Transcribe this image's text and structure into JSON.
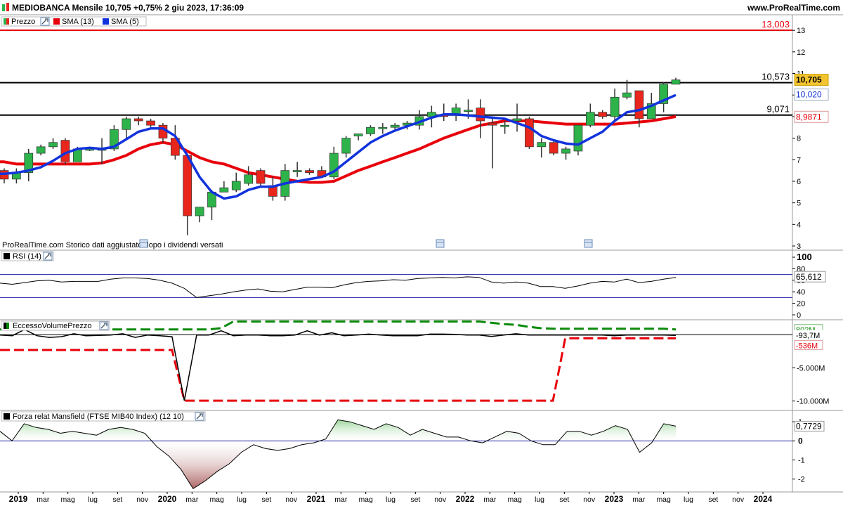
{
  "header": {
    "title": "MEDIOBANCA Mensile 10,705 +0,75% 2 giu 2023, 17:36:09",
    "brand": "www.ProRealTime.com"
  },
  "indicators": {
    "price_label": "Prezzo",
    "sma13_label": "SMA (13)",
    "sma5_label": "SMA (5)"
  },
  "footnote": "ProRealTime.com  Storico dati aggiustato dopo i dividendi versati",
  "colors": {
    "up": "#2db34a",
    "down": "#e8261c",
    "sma13": "#e8000b",
    "sma5": "#1133dd",
    "highlight": "#f4c430",
    "grid_dash": "#0a8a0a",
    "hline_blue": "#2020a0"
  },
  "chart_data": [
    {
      "type": "candlestick",
      "name": "Prezzo",
      "ylim": [
        3,
        13.2
      ],
      "yticks": [
        "3",
        "4",
        "5",
        "6",
        "7",
        "8",
        "9",
        "10",
        "11",
        "12",
        "13"
      ],
      "hlines": [
        {
          "value": 13.003,
          "label": "13,003",
          "color": "#e8000b"
        },
        {
          "value": 10.573,
          "label": "10,573",
          "color": "#000000"
        },
        {
          "value": 9.071,
          "label": "9,071",
          "color": "#000000"
        }
      ],
      "price_tags": [
        {
          "value": 10.705,
          "label": "10,705",
          "style": "highlight"
        },
        {
          "value": 10.02,
          "label": "10,020",
          "style": "blue"
        },
        {
          "value": 8.987,
          "label": "8,9871",
          "style": "red"
        }
      ],
      "candles": [
        [
          6.5,
          6.6,
          5.9,
          6.1
        ],
        [
          6.1,
          6.6,
          5.9,
          6.4
        ],
        [
          6.4,
          7.5,
          6.0,
          7.3
        ],
        [
          7.3,
          7.7,
          7.2,
          7.6
        ],
        [
          7.6,
          8.0,
          7.5,
          7.8
        ],
        [
          7.9,
          8.0,
          6.8,
          6.9
        ],
        [
          6.9,
          7.6,
          6.9,
          7.5
        ],
        [
          7.5,
          7.6,
          7.4,
          7.5
        ],
        [
          7.5,
          8.0,
          6.8,
          7.5
        ],
        [
          7.5,
          8.6,
          7.4,
          8.4
        ],
        [
          8.4,
          9.0,
          8.0,
          8.9
        ],
        [
          8.9,
          9.0,
          8.6,
          8.8
        ],
        [
          8.8,
          8.9,
          8.4,
          8.6
        ],
        [
          8.6,
          8.7,
          7.8,
          8.0
        ],
        [
          8.0,
          8.6,
          7.0,
          7.2
        ],
        [
          7.2,
          7.2,
          3.5,
          4.4
        ],
        [
          4.4,
          4.8,
          4.1,
          4.8
        ],
        [
          4.8,
          5.6,
          4.2,
          5.5
        ],
        [
          5.5,
          6.0,
          5.5,
          5.7
        ],
        [
          5.6,
          6.4,
          5.5,
          6.0
        ],
        [
          5.9,
          6.7,
          5.8,
          6.3
        ],
        [
          6.5,
          6.6,
          5.7,
          5.9
        ],
        [
          5.8,
          6.2,
          5.1,
          5.3
        ],
        [
          5.3,
          6.8,
          5.1,
          6.5
        ],
        [
          6.5,
          6.9,
          6.2,
          6.5
        ],
        [
          6.5,
          6.6,
          6.3,
          6.4
        ],
        [
          6.5,
          6.7,
          6.2,
          6.2
        ],
        [
          6.2,
          7.6,
          6.1,
          7.3
        ],
        [
          7.3,
          8.1,
          7.1,
          8.0
        ],
        [
          8.1,
          8.2,
          7.9,
          8.2
        ],
        [
          8.2,
          8.6,
          8.1,
          8.5
        ],
        [
          8.5,
          8.7,
          8.2,
          8.5
        ],
        [
          8.5,
          8.7,
          8.4,
          8.6
        ],
        [
          8.6,
          8.8,
          8.4,
          8.7
        ],
        [
          8.6,
          9.3,
          8.4,
          9.0
        ],
        [
          9.0,
          9.5,
          8.5,
          9.2
        ],
        [
          9.1,
          9.6,
          8.8,
          9.0
        ],
        [
          9.1,
          9.6,
          8.8,
          9.4
        ],
        [
          9.3,
          9.8,
          8.9,
          9.3
        ],
        [
          9.4,
          9.8,
          8.0,
          8.8
        ],
        [
          8.7,
          8.9,
          6.6,
          8.6
        ],
        [
          8.6,
          8.8,
          8.2,
          8.6
        ],
        [
          8.8,
          9.6,
          8.3,
          8.9
        ],
        [
          8.9,
          9.0,
          7.5,
          7.6
        ],
        [
          7.6,
          8.0,
          7.1,
          7.8
        ],
        [
          7.8,
          7.9,
          7.2,
          7.3
        ],
        [
          7.3,
          7.6,
          7.0,
          7.5
        ],
        [
          7.4,
          8.6,
          7.2,
          8.6
        ],
        [
          8.6,
          9.6,
          8.5,
          9.2
        ],
        [
          9.2,
          9.3,
          8.9,
          9.0
        ],
        [
          9.0,
          10.3,
          8.8,
          9.9
        ],
        [
          9.9,
          10.7,
          9.8,
          10.1
        ],
        [
          10.2,
          10.2,
          8.5,
          8.9
        ],
        [
          8.9,
          10.1,
          8.9,
          9.6
        ],
        [
          9.6,
          10.6,
          9.2,
          10.5
        ],
        [
          10.5,
          10.8,
          10.5,
          10.7
        ]
      ],
      "sma13": [
        6.9,
        6.8,
        6.8,
        6.8,
        6.8,
        6.8,
        6.8,
        6.8,
        6.85,
        7.0,
        7.2,
        7.5,
        7.7,
        7.8,
        7.7,
        7.4,
        7.1,
        6.9,
        6.8,
        6.6,
        6.4,
        6.3,
        6.2,
        6.1,
        6.0,
        5.95,
        5.95,
        6.0,
        6.25,
        6.5,
        6.7,
        6.9,
        7.1,
        7.3,
        7.5,
        7.75,
        8.0,
        8.2,
        8.4,
        8.6,
        8.7,
        8.8,
        8.8,
        8.8,
        8.75,
        8.7,
        8.65,
        8.65,
        8.65,
        8.65,
        8.65,
        8.7,
        8.75,
        8.8,
        8.9,
        9.0
      ],
      "sma5": [
        6.35,
        6.4,
        6.5,
        6.65,
        6.95,
        7.3,
        7.5,
        7.55,
        7.5,
        7.6,
        7.95,
        8.3,
        8.45,
        8.45,
        8.1,
        7.2,
        6.2,
        5.5,
        5.2,
        5.3,
        5.6,
        5.75,
        5.75,
        5.9,
        6.0,
        6.1,
        6.2,
        6.45,
        6.9,
        7.35,
        7.8,
        8.1,
        8.35,
        8.55,
        8.75,
        8.95,
        9.1,
        9.1,
        9.05,
        9.0,
        8.95,
        8.9,
        8.7,
        8.5,
        8.1,
        7.9,
        7.75,
        7.7,
        8.0,
        8.3,
        8.8,
        9.2,
        9.3,
        9.5,
        9.75,
        10.0
      ]
    },
    {
      "type": "line",
      "name": "RSI (14)",
      "ylim": [
        0,
        100
      ],
      "yticks": [
        "100",
        "80",
        "60",
        "40",
        "20",
        "0"
      ],
      "hlines": [
        70,
        30
      ],
      "last_label": "65,612",
      "values": [
        55,
        53,
        56,
        59,
        60,
        57,
        58,
        58,
        58,
        62,
        64,
        64,
        63,
        60,
        55,
        46,
        30,
        33,
        36,
        40,
        43,
        45,
        41,
        40,
        44,
        48,
        48,
        47,
        52,
        56,
        58,
        59,
        61,
        60,
        63,
        64,
        65,
        64,
        66,
        65,
        57,
        55,
        57,
        55,
        49,
        49,
        46,
        50,
        55,
        58,
        57,
        62,
        56,
        58,
        62,
        65
      ]
    },
    {
      "type": "line",
      "name": "EccessoVolumePrezzo",
      "ylim": [
        -11000,
        1200
      ],
      "yticks": [
        "-5.000M",
        "-10.000M"
      ],
      "last_labels": [
        "802M",
        "-93,7M",
        "-536M"
      ],
      "values": [
        -50,
        -150,
        800,
        -150,
        -400,
        -300,
        150,
        -150,
        -100,
        -50,
        150,
        -400,
        -50,
        -150,
        -300,
        -9950,
        -50,
        -50,
        600,
        -150,
        -50,
        -50,
        -150,
        -150,
        -50,
        600,
        -50,
        300,
        -150,
        -50,
        100,
        -50,
        -150,
        -150,
        -150,
        100,
        100,
        50,
        -50,
        -50,
        -250,
        -50,
        150,
        -50,
        -50,
        -50,
        -50,
        -50,
        -50,
        -50,
        -150,
        -50,
        -50,
        -50,
        -50,
        -93.7
      ],
      "upper_band": [
        800,
        800,
        800,
        800,
        800,
        800,
        800,
        800,
        800,
        800,
        800,
        800,
        800,
        800,
        800,
        800,
        800,
        800,
        1000,
        2000,
        2000,
        2000,
        2000,
        2000,
        2000,
        2000,
        2000,
        2000,
        2000,
        2000,
        2000,
        2000,
        2000,
        2000,
        2000,
        2000,
        2000,
        2000,
        2000,
        2000,
        1800,
        1600,
        1500,
        1200,
        1000,
        900,
        900,
        900,
        900,
        900,
        900,
        900,
        900,
        900,
        900,
        802
      ],
      "lower_band": [
        -2300,
        -2300,
        -2300,
        -2300,
        -2300,
        -2300,
        -2300,
        -2300,
        -2300,
        -2300,
        -2300,
        -2300,
        -2300,
        -2300,
        -2300,
        -9950,
        -9950,
        -9950,
        -9950,
        -9950,
        -9950,
        -9950,
        -9950,
        -9950,
        -9950,
        -9950,
        -9950,
        -9950,
        -9950,
        -9950,
        -9950,
        -9950,
        -9950,
        -9950,
        -9950,
        -9950,
        -9950,
        -9950,
        -9950,
        -9950,
        -9950,
        -9950,
        -9950,
        -9950,
        -9950,
        -9950,
        -536,
        -536,
        -536,
        -536,
        -536,
        -536,
        -536,
        -536,
        -536,
        -536
      ]
    },
    {
      "type": "area",
      "name": "Forza relat Mansfield (FTSE MIB40 Index) (12 10)",
      "ylim": [
        -2.6,
        1.3
      ],
      "yticks": [
        "1",
        "0",
        "-1",
        "-2"
      ],
      "last_label": "0,7729",
      "values": [
        0.5,
        0.0,
        0.9,
        0.7,
        0.6,
        0.4,
        0.5,
        0.4,
        0.3,
        0.6,
        0.7,
        0.6,
        0.4,
        -0.3,
        -0.8,
        -1.5,
        -2.5,
        -2.1,
        -1.6,
        -1.2,
        -0.6,
        -0.2,
        -0.4,
        -0.5,
        -0.4,
        -0.2,
        -0.1,
        0.1,
        1.1,
        1.0,
        0.8,
        0.6,
        0.9,
        0.7,
        0.3,
        0.6,
        0.4,
        0.2,
        0.2,
        0.0,
        -0.1,
        0.2,
        0.5,
        0.4,
        0.0,
        -0.2,
        -0.2,
        0.5,
        0.5,
        0.3,
        0.5,
        0.8,
        0.6,
        -0.6,
        -0.1,
        0.9,
        0.77
      ]
    }
  ],
  "xaxis": {
    "labels": [
      "2019",
      "mar",
      "mag",
      "lug",
      "set",
      "nov",
      "2020",
      "mar",
      "mag",
      "lug",
      "set",
      "nov",
      "2021",
      "mar",
      "mag",
      "lug",
      "set",
      "nov",
      "2022",
      "mar",
      "mag",
      "lug",
      "set",
      "nov",
      "2023",
      "mar",
      "mag",
      "lug",
      "set",
      "nov",
      "2024"
    ],
    "bold": [
      "2019",
      "2020",
      "2021",
      "2022",
      "2023",
      "2024"
    ]
  }
}
